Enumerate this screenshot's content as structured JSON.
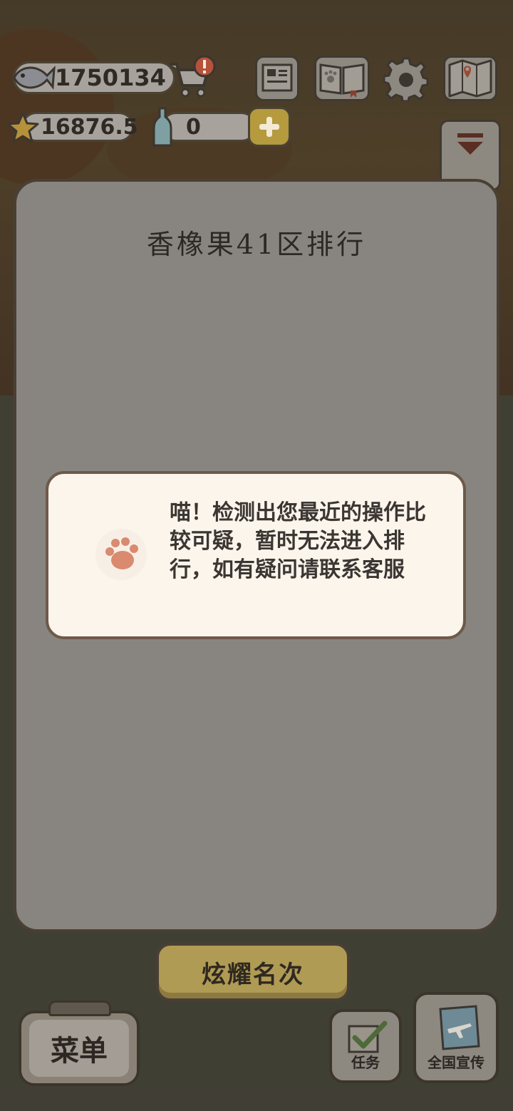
{
  "currency": {
    "fish": "1750134",
    "stars": "16876.5",
    "bottles": "0"
  },
  "ranking_modal": {
    "title": "香橡果41区排行"
  },
  "toast": {
    "message": "喵！检测出您最近的操作比较可疑，暂时无法进入排行，如有疑问请联系客服"
  },
  "buttons": {
    "brag": "炫耀名次",
    "menu": "菜单",
    "tasks": "任务",
    "promo": "全国宣传"
  },
  "colors": {
    "accent_gold": "#b09b55",
    "paw": "#d98a6f"
  }
}
